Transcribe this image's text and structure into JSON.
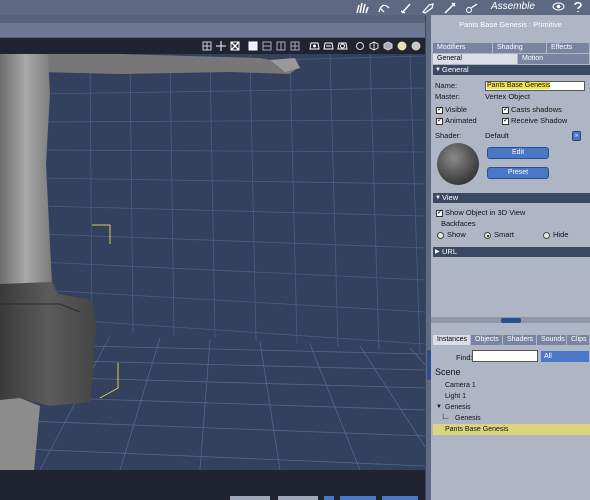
{
  "topbar": {
    "room_label": "Assemble",
    "icons": [
      "pose-hand-icon",
      "morph-icon",
      "brush-icon",
      "bone-icon",
      "pen-icon",
      "node-icon",
      "eye-icon",
      "help-icon"
    ]
  },
  "viewport": {
    "toolbar_icons": [
      "grid-icon",
      "move-icon",
      "fit-icon",
      "layout-1-icon",
      "layout-2-icon",
      "layout-3-icon",
      "layout-4-icon",
      "camera-icon",
      "pan-icon",
      "orbit-icon",
      "rotate-icon",
      "wire-box-icon",
      "solid-box-icon",
      "shaded-sphere-icon",
      "smooth-sphere-icon"
    ]
  },
  "panel": {
    "title": "Pants Base Genesis : Primitive",
    "tabs_row1": [
      "Modifiers",
      "Shading",
      "Effects"
    ],
    "tabs_row2": [
      "General",
      "Motion"
    ],
    "active_tab": "General",
    "general": {
      "header": "General",
      "name_label": "Name:",
      "name_value": "Pants Base Genesis",
      "master_label": "Master:",
      "master_value": "Vertex Object",
      "visible": "Visible",
      "casts_shadows": "Casts shadows",
      "animated": "Animated",
      "receive_shadow": "Receive Shadow",
      "shader_label": "Shader:",
      "shader_value": "Default",
      "edit_button": "Edit",
      "preset_button": "Preset"
    },
    "view": {
      "header": "View",
      "show_in_3d": "Show Object in 3D View",
      "backfaces_label": "Backfaces",
      "opt_show": "Show",
      "opt_smart": "Smart",
      "opt_hide": "Hide",
      "selected": "Smart"
    },
    "url": {
      "header": "URL"
    },
    "browser": {
      "tabs": [
        "Instances",
        "Objects",
        "Shaders",
        "Sounds",
        "Clips"
      ],
      "active_tab": "Instances",
      "find_label": "Find:",
      "find_value": "",
      "filter_value": "All",
      "scene_header": "Scene",
      "items": [
        {
          "label": "Camera 1",
          "indent": 1
        },
        {
          "label": "Light 1",
          "indent": 1
        },
        {
          "label": "Genesis",
          "indent": 1,
          "expanded": true
        },
        {
          "label": "Genesis",
          "indent": 2
        },
        {
          "label": "Pants Base Genesis",
          "indent": 0,
          "selected": true
        }
      ]
    }
  }
}
